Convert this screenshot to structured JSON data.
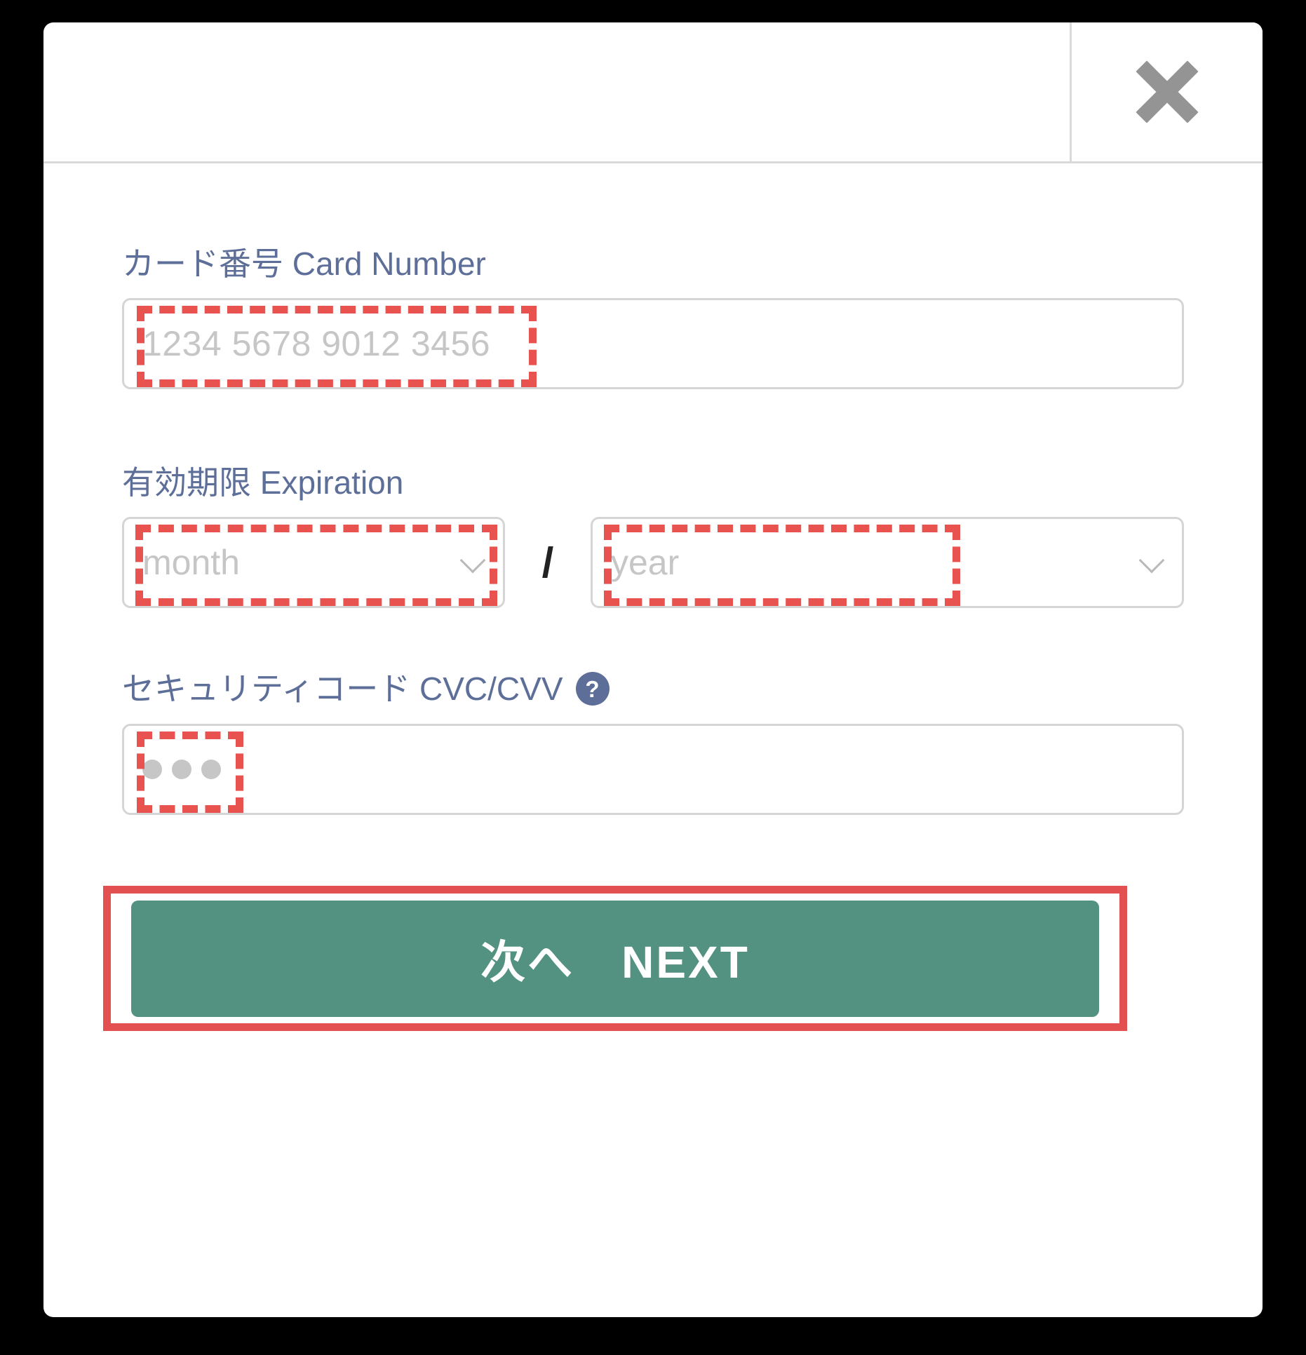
{
  "modal": {
    "header": {
      "title": "",
      "close_icon": "close-icon"
    },
    "fields": {
      "card": {
        "label": "カード番号 Card Number",
        "placeholder": "1234 5678 9012 3456",
        "value": ""
      },
      "expiration": {
        "label": "有効期限 Expiration",
        "separator": "/",
        "month": {
          "placeholder": "month",
          "value": "",
          "caret_icon": "chevron-down-icon"
        },
        "year": {
          "placeholder": "year",
          "value": "",
          "caret_icon": "chevron-down-icon"
        }
      },
      "cvc": {
        "label": "セキュリティコード CVC/CVV",
        "help_icon_label": "?",
        "masked_value": "•••",
        "dot_count": 3
      }
    },
    "footer": {
      "next_label": "次へ　NEXT"
    }
  },
  "colors": {
    "backdrop": "#000000",
    "modal_bg": "#ffffff",
    "label_text": "#5d6f99",
    "placeholder_text": "#c6c6c6",
    "input_border": "#d5d5d5",
    "highlight_red": "#e8534f",
    "button_outline_red": "#e2514f",
    "next_button_green": "#539180",
    "close_icon_gray": "#949494",
    "divider_gray": "#d9d9d9"
  }
}
